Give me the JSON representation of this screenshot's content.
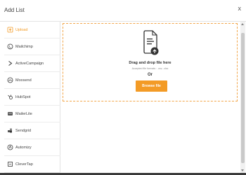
{
  "dialog": {
    "title": "Add List",
    "close_label": "x"
  },
  "sidebar": {
    "items": [
      {
        "label": "Upload",
        "icon": "upload-icon",
        "active": true
      },
      {
        "label": "Mailchimp",
        "icon": "mailchimp-icon"
      },
      {
        "label": "ActiveCampaign",
        "icon": "activecampaign-icon"
      },
      {
        "label": "Moosend",
        "icon": "moosend-icon"
      },
      {
        "label": "HubSpot",
        "icon": "hubspot-icon"
      },
      {
        "label": "MailerLite",
        "icon": "mailerlite-icon"
      },
      {
        "label": "Sendgrid",
        "icon": "sendgrid-icon"
      },
      {
        "label": "Automizy",
        "icon": "automizy-icon"
      },
      {
        "label": "CleverTap",
        "icon": "clevertap-icon"
      }
    ]
  },
  "upload": {
    "title": "Drag and drop file here",
    "subtitle": "Accepted file formats : .csv, .xlsx",
    "or_label": "Or",
    "browse_label": "Browse file"
  },
  "colors": {
    "accent": "#f39b26",
    "dropzone_border": "#f2a64a"
  }
}
